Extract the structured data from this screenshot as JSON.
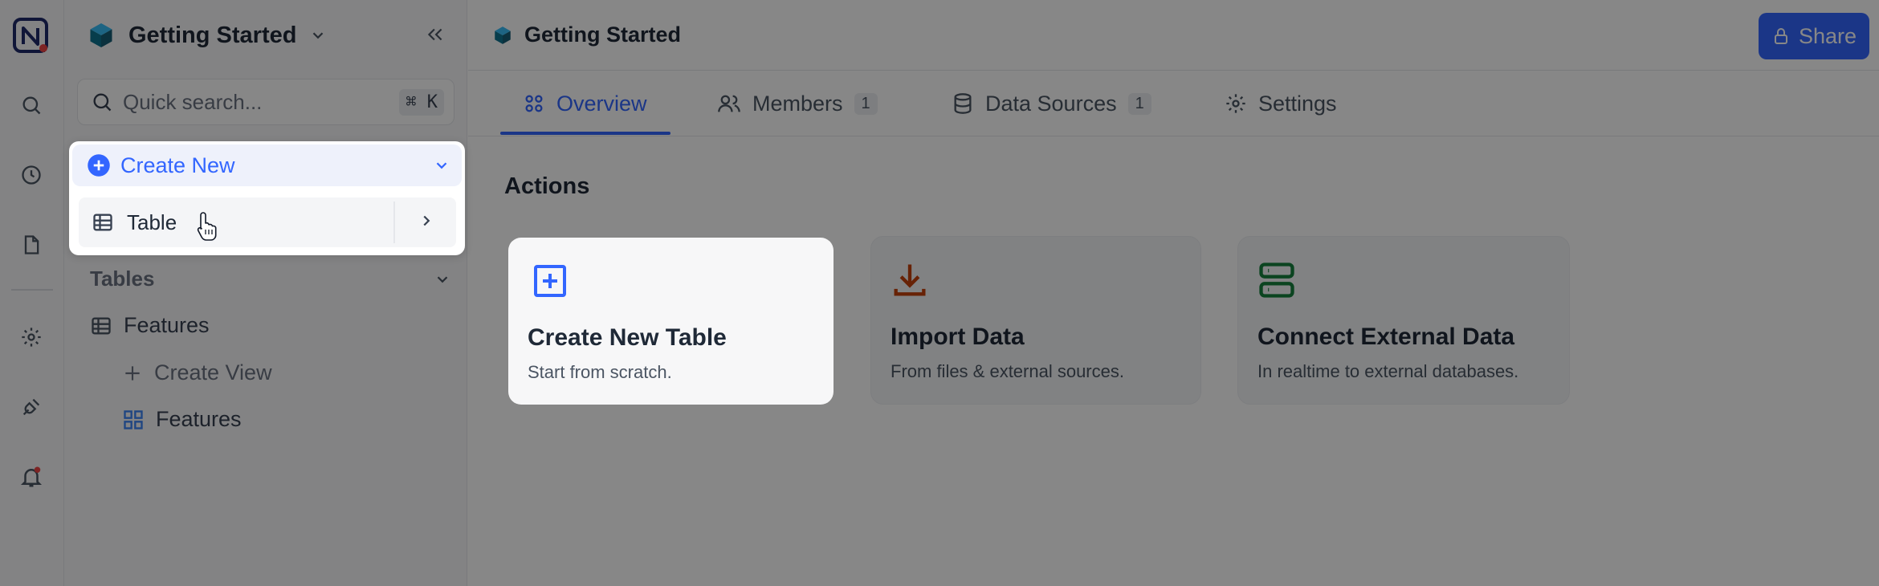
{
  "workspace": {
    "name": "Getting Started"
  },
  "search": {
    "placeholder": "Quick search...",
    "shortcut": "⌘ K"
  },
  "create_menu": {
    "label": "Create New",
    "items": [
      {
        "label": "Table"
      }
    ]
  },
  "tables_section": {
    "label": "Tables",
    "table": {
      "name": "Features"
    },
    "create_view": "Create View",
    "view": {
      "name": "Features"
    }
  },
  "header": {
    "title": "Getting Started",
    "share_label": "Share"
  },
  "tabs": [
    {
      "label": "Overview"
    },
    {
      "label": "Members",
      "count": "1"
    },
    {
      "label": "Data Sources",
      "count": "1"
    },
    {
      "label": "Settings"
    }
  ],
  "actions": {
    "heading": "Actions",
    "cards": [
      {
        "title": "Create New Table",
        "subtitle": "Start from scratch.",
        "icon": "plus-square-icon"
      },
      {
        "title": "Import Data",
        "subtitle": "From files & external sources.",
        "icon": "download-icon"
      },
      {
        "title": "Connect External Data",
        "subtitle": "In realtime to external databases.",
        "icon": "server-icon"
      }
    ]
  },
  "colors": {
    "accent": "#3366ff",
    "import": "#c2410c",
    "connect": "#15803d",
    "notification": "#ef4444"
  }
}
